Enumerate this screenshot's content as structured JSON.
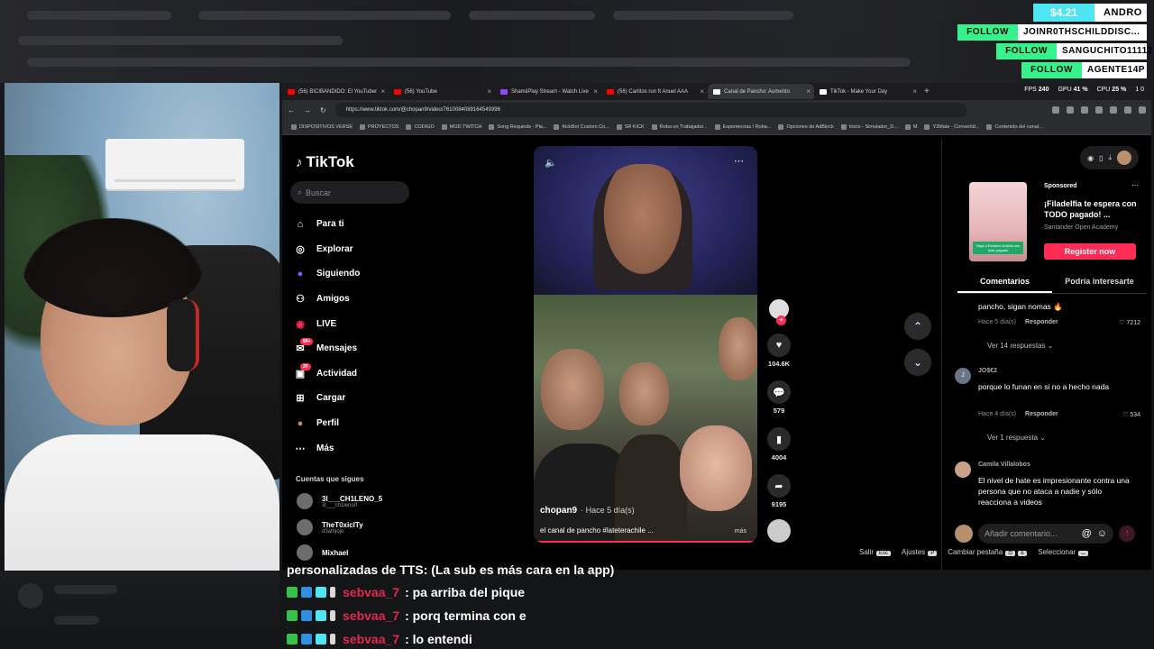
{
  "alerts": {
    "donation_amount": "$4.21",
    "donation_user": "ANDRO",
    "follows": [
      {
        "tag": "FOLLOW",
        "name": "JOINR0THSCHILDDISC..."
      },
      {
        "tag": "FOLLOW",
        "name": "SANGUCHITO11112"
      },
      {
        "tag": "FOLLOW",
        "name": "AGENTE14P"
      }
    ]
  },
  "browser": {
    "tabs": [
      {
        "label": "(56) BICIBANDIDO: El YouTuber"
      },
      {
        "label": "(56) YouTube"
      },
      {
        "label": "ShamiiPlay Stream - Watch Live"
      },
      {
        "label": "(56) Carlitos run ft Anuel AAA"
      },
      {
        "label": "Canal de Pancho: Aumento"
      },
      {
        "label": "TikTok - Make Your Day"
      }
    ],
    "new_tab": "+",
    "stats": {
      "fps_label": "FPS",
      "fps": "240",
      "gpu_label": "GPU",
      "gpu": "41 %",
      "cpu_label": "CPU",
      "cpu": "25 %",
      "extra": "1 0"
    },
    "url": "https://www.tiktok.com/@chopan9/video/7610084089164549396",
    "bookmarks": [
      "DISPOSITIVOS VERSE",
      "PROYECTOS",
      "CODIGO",
      "MOD TWITCH",
      "Song Requests - Pla...",
      "KickBot Custom Co...",
      "SR KICK",
      "Roba un Trabajador...",
      "Experiencias / Roba...",
      "Opciones de AdBlock",
      "Inicio - Simulador_D...",
      "M",
      "Y2Mate - Convertid...",
      "Contenido del canal..."
    ]
  },
  "tiktok": {
    "logo": "TikTok",
    "search_placeholder": "Buscar",
    "nav": [
      {
        "label": "Para ti",
        "icon": "home-icon",
        "glyph": "⌂"
      },
      {
        "label": "Explorar",
        "icon": "compass-icon",
        "glyph": "◎"
      },
      {
        "label": "Siguiendo",
        "icon": "following-icon",
        "glyph": "●"
      },
      {
        "label": "Amigos",
        "icon": "friends-icon",
        "glyph": "⚇"
      },
      {
        "label": "LIVE",
        "icon": "live-icon",
        "glyph": "◉"
      },
      {
        "label": "Mensajes",
        "icon": "messages-icon",
        "glyph": "✉",
        "badge": "99+"
      },
      {
        "label": "Actividad",
        "icon": "activity-icon",
        "glyph": "▣",
        "badge": "26"
      },
      {
        "label": "Cargar",
        "icon": "upload-icon",
        "glyph": "⊞"
      },
      {
        "label": "Perfil",
        "icon": "profile-icon",
        "glyph": "●"
      },
      {
        "label": "Más",
        "icon": "more-icon",
        "glyph": "⋯"
      }
    ],
    "following_title": "Cuentas que sigues",
    "accounts": [
      {
        "name": "3l___CH1LENO_5",
        "handle": "3l___ch1leno0"
      },
      {
        "name": "TheT0xiclTy",
        "handle": "d3athjojo"
      },
      {
        "name": "Mixhael",
        "handle": ""
      }
    ]
  },
  "video": {
    "author": "chopan9",
    "ago": "· Hace 5 día(s)",
    "description": "el canal de pancho #lateterachile ...",
    "more": "más",
    "progress": 0.98,
    "likes": "104.6K",
    "comments": "579",
    "saves": "4004",
    "shares": "9195"
  },
  "sidebar": {
    "sponsored": "Sponsored",
    "ad_title": "¡Filadelfia te espera con TODO pagado! ...",
    "ad_brand": "Santander Open Academy",
    "ad_caption": "Viaja a Estados Unidos con todo pagado",
    "cta": "Register now",
    "tab_comments": "Comentarios",
    "tab_interest": "Podría interesarte",
    "comments": [
      {
        "user": "",
        "text": "pancho, sigan nomas 🔥",
        "ago": "Hace 5 día(s)",
        "reply": "Responder",
        "likes": "7212",
        "replies": "Ver 14 respuestas ⌄"
      },
      {
        "user": "JO$€2",
        "avatar": "J",
        "text": "porque lo funan en si no a hecho nada",
        "ago": "Hace 4 día(s)",
        "reply": "Responder",
        "likes": "534",
        "replies": "Ver 1 respuesta ⌄"
      },
      {
        "user": "Camila Villalobos",
        "avatar": "",
        "text": "El nivel de hate es impresionante contra una persona que no ataca a nadie y sólo reacciona a videos",
        "ago": "",
        "reply": "",
        "likes": "",
        "replies": ""
      }
    ],
    "comment_placeholder": "Añadir comentario...",
    "at_symbol": "@",
    "emoji_symbol": "☺"
  },
  "shortcuts": {
    "exit": "Salir",
    "exit_key": "Esc",
    "settings": "Ajustes",
    "settings_key": "P",
    "switch_tab": "Cambiar pestaña",
    "switch_key1": "⊡",
    "switch_key2": "E",
    "select": "Seleccionar",
    "select_key": "⌴"
  },
  "chat": {
    "cut_line": "personalizadas de TTS: (La sub es más cara en la app)",
    "messages": [
      {
        "user": "sebvaa_7",
        "text": ": pa arriba del pique"
      },
      {
        "user": "sebvaa_7",
        "text": ": porq termina con e"
      },
      {
        "user": "sebvaa_7",
        "text": ": lo entendi"
      }
    ]
  },
  "colors": {
    "accent": "#fe2c55",
    "follow_green": "#35f28b",
    "donation_cyan": "#4ee6f2",
    "chat_user": "#e0294f"
  }
}
